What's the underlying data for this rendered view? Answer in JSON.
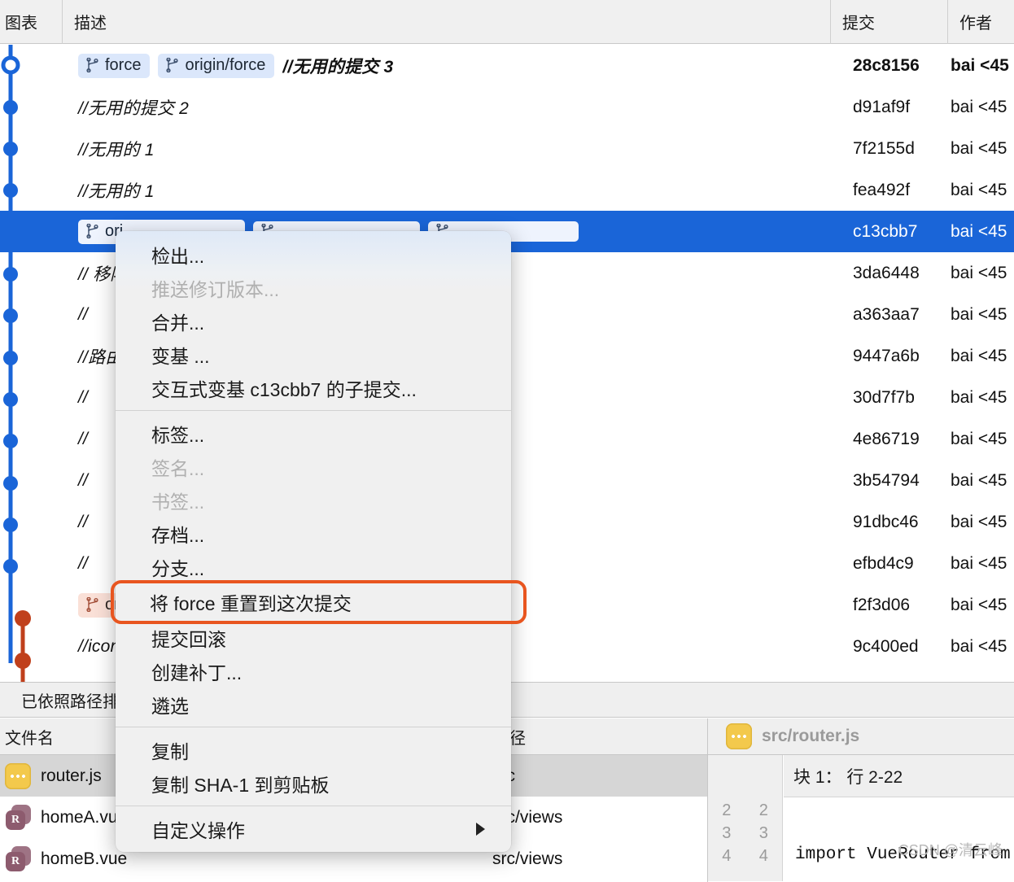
{
  "app": {
    "columns": {
      "graph": "图表",
      "description": "描述",
      "commit": "提交",
      "author": "作者"
    }
  },
  "commits": [
    {
      "chips": [
        {
          "label": "force",
          "style": "local"
        },
        {
          "label": "origin/force",
          "style": "local"
        }
      ],
      "desc": "//无用的提交 3",
      "hash": "28c8156",
      "author": "bai <45",
      "selected": false,
      "bold": true,
      "node": "open",
      "color": "#1a65d8"
    },
    {
      "chips": [],
      "desc": "//无用的提交 2",
      "hash": "d91af9f",
      "author": "bai <45",
      "selected": false,
      "bold": false,
      "node": "solid",
      "color": "#1a65d8"
    },
    {
      "chips": [],
      "desc": "//无用的 1",
      "hash": "7f2155d",
      "author": "bai <45",
      "selected": false,
      "bold": false,
      "node": "solid",
      "color": "#1a65d8"
    },
    {
      "chips": [],
      "desc": "//无用的  1",
      "hash": "fea492f",
      "author": "bai <45",
      "selected": false,
      "bold": false,
      "node": "solid",
      "color": "#1a65d8"
    },
    {
      "chips": [
        {
          "label": "ori",
          "style": "sel"
        },
        {
          "label": "",
          "style": "sel"
        },
        {
          "label": "",
          "style": "sel"
        }
      ],
      "desc": "",
      "hash": "c13cbb7",
      "author": "bai <45",
      "selected": true,
      "bold": false,
      "node": "open",
      "color": "#1a65d8"
    },
    {
      "chips": [],
      "desc": "// 移除",
      "hash": "3da6448",
      "author": "bai <45",
      "selected": false,
      "bold": false,
      "node": "solid",
      "color": "#1a65d8"
    },
    {
      "chips": [],
      "desc": "//",
      "hash": "a363aa7",
      "author": "bai <45",
      "selected": false,
      "bold": false,
      "node": "solid",
      "color": "#1a65d8"
    },
    {
      "chips": [],
      "desc": "//路由",
      "hash": "9447a6b",
      "author": "bai <45",
      "selected": false,
      "bold": false,
      "node": "solid",
      "color": "#1a65d8"
    },
    {
      "chips": [],
      "desc": "//",
      "hash": "30d7f7b",
      "author": "bai <45",
      "selected": false,
      "bold": false,
      "node": "solid",
      "color": "#1a65d8"
    },
    {
      "chips": [],
      "desc": "//",
      "hash": "4e86719",
      "author": "bai <45",
      "selected": false,
      "bold": false,
      "node": "solid",
      "color": "#1a65d8"
    },
    {
      "chips": [],
      "desc": "//",
      "hash": "3b54794",
      "author": "bai <45",
      "selected": false,
      "bold": false,
      "node": "solid",
      "color": "#1a65d8"
    },
    {
      "chips": [],
      "desc": "//",
      "hash": "91dbc46",
      "author": "bai <45",
      "selected": false,
      "bold": false,
      "node": "solid",
      "color": "#1a65d8"
    },
    {
      "chips": [],
      "desc": "//",
      "hash": "efbd4c9",
      "author": "bai <45",
      "selected": false,
      "bold": false,
      "node": "solid",
      "color": "#1a65d8"
    },
    {
      "chips": [
        {
          "label": "ori",
          "style": "remote"
        }
      ],
      "desc": "",
      "hash": "f2f3d06",
      "author": "bai <45",
      "selected": false,
      "bold": false,
      "node": "solid",
      "color": "#c0401c"
    },
    {
      "chips": [],
      "desc": "//icon",
      "hash": "9c400ed",
      "author": "bai <45",
      "selected": false,
      "bold": false,
      "node": "solid",
      "color": "#c0401c"
    }
  ],
  "context_menu": {
    "groups": [
      [
        {
          "label": "检出...",
          "disabled": false,
          "highlight": false,
          "submenu": false
        },
        {
          "label": "推送修订版本...",
          "disabled": true,
          "highlight": false,
          "submenu": false
        },
        {
          "label": "合并...",
          "disabled": false,
          "highlight": false,
          "submenu": false
        },
        {
          "label": "变基 ...",
          "disabled": false,
          "highlight": false,
          "submenu": false
        },
        {
          "label": "交互式变基 c13cbb7 的子提交...",
          "disabled": false,
          "highlight": false,
          "submenu": false
        }
      ],
      [
        {
          "label": "标签...",
          "disabled": false,
          "highlight": false,
          "submenu": false
        },
        {
          "label": "签名...",
          "disabled": true,
          "highlight": false,
          "submenu": false
        },
        {
          "label": "书签...",
          "disabled": true,
          "highlight": false,
          "submenu": false
        },
        {
          "label": "存档...",
          "disabled": false,
          "highlight": false,
          "submenu": false
        },
        {
          "label": "分支...",
          "disabled": false,
          "highlight": false,
          "submenu": false
        },
        {
          "label": "将 force 重置到这次提交",
          "disabled": false,
          "highlight": true,
          "submenu": false
        },
        {
          "label": "提交回滚",
          "disabled": false,
          "highlight": false,
          "submenu": false
        },
        {
          "label": "创建补丁...",
          "disabled": false,
          "highlight": false,
          "submenu": false
        },
        {
          "label": "遴选",
          "disabled": false,
          "highlight": false,
          "submenu": false
        }
      ],
      [
        {
          "label": "复制",
          "disabled": false,
          "highlight": false,
          "submenu": false
        },
        {
          "label": "复制 SHA-1 到剪贴板",
          "disabled": false,
          "highlight": false,
          "submenu": false
        }
      ],
      [
        {
          "label": "自定义操作",
          "disabled": false,
          "highlight": false,
          "submenu": true
        }
      ]
    ]
  },
  "statusbar": {
    "text": "已依照路径排"
  },
  "file_pane": {
    "columns": {
      "name": "文件名",
      "path": "路径"
    },
    "rows": [
      {
        "name": "router.js",
        "path": "src",
        "icon": "js-file-icon",
        "selected": true
      },
      {
        "name": "homeA.vue",
        "path": "src/views",
        "icon": "vue-file-icon",
        "selected": false
      },
      {
        "name": "homeB.vue",
        "path": "src/views",
        "icon": "vue-file-icon",
        "selected": false
      }
    ]
  },
  "diff_pane": {
    "file_title": "src/router.js",
    "file_icon": "js-file-icon",
    "hunk_header": "块 1： 行 2-22",
    "gutter": [
      [
        "2",
        "2"
      ],
      [
        "3",
        "3"
      ],
      [
        "4",
        "4"
      ]
    ],
    "code_lines": [
      "",
      "",
      "import VueRouter from"
    ],
    "watermark": "CSDN @清云峰"
  },
  "colors": {
    "selection": "#1a65d8",
    "graph_blue": "#1a65d8",
    "graph_red": "#c0401c",
    "highlight_outline": "#e8551f",
    "chip_bg": "#dbe7fb",
    "chip_remote_bg": "#fae0d7"
  }
}
